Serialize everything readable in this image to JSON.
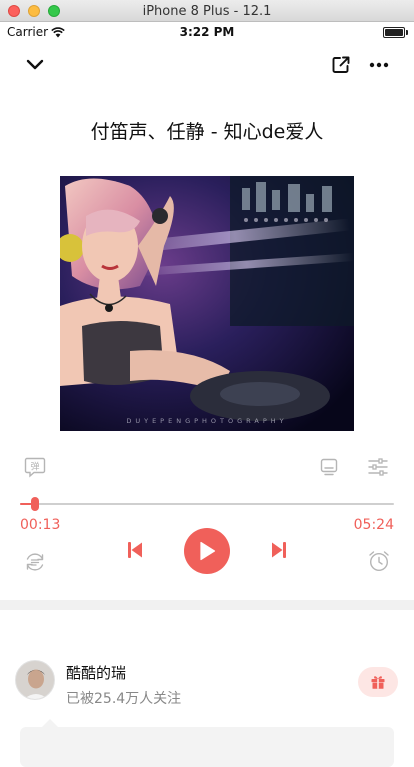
{
  "window": {
    "title": "iPhone 8 Plus - 12.1"
  },
  "status_bar": {
    "carrier": "Carrier",
    "time": "3:22 PM"
  },
  "nav": {
    "left_icon": "chevron-down-icon",
    "share_icon": "share-icon",
    "more_icon": "more-icon"
  },
  "song": {
    "title": "付笛声、任静 - 知心de爱人"
  },
  "cover": {
    "watermark": "DUYEPENGPHOTOGRAPHY"
  },
  "controls": {
    "danmaku_icon_label": "弹",
    "progress": 0.04,
    "current_time": "00:13",
    "total_time": "05:24"
  },
  "artist": {
    "name": "酷酷的瑞",
    "followers": "已被25.4万人关注"
  },
  "colors": {
    "accent": "#f0605a"
  }
}
